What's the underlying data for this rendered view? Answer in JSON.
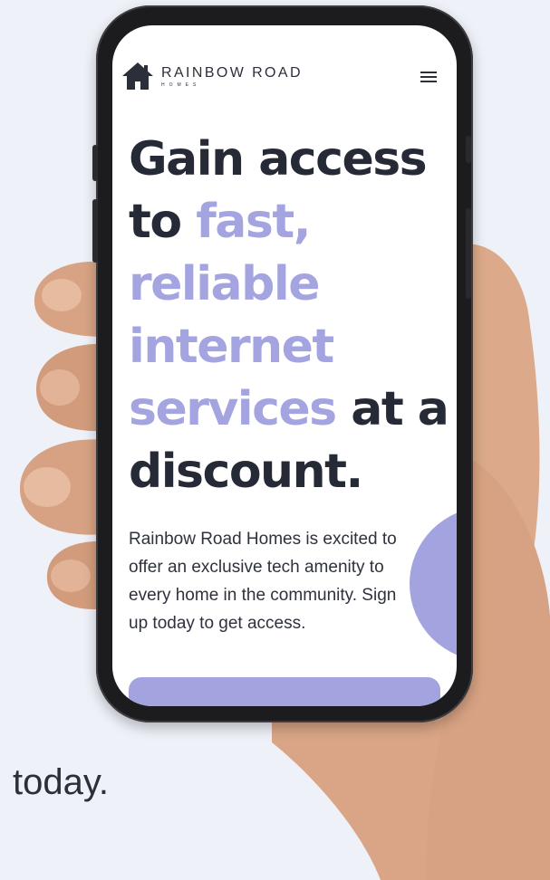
{
  "brand": {
    "name": "RAINBOW ROAD",
    "sub": "HOMES"
  },
  "headline": {
    "line1": "Gain access",
    "line2_dark": "to ",
    "line2_accent": "fast,",
    "line3_accent": "reliable",
    "line4_accent": "internet",
    "line5_accent": "services",
    "line5_dark": " at a",
    "line6_dark": "discount."
  },
  "intro": "Rainbow Road Homes is excited to offer an exclusive tech amenity to every home in the community. Sign up today to get access.",
  "outside_text": "today.",
  "colors": {
    "accent": "#a3a4df",
    "dark_text": "#262a36",
    "background": "#eef1f8"
  },
  "icons": {
    "logo": "house-icon",
    "menu": "hamburger-menu-icon"
  }
}
